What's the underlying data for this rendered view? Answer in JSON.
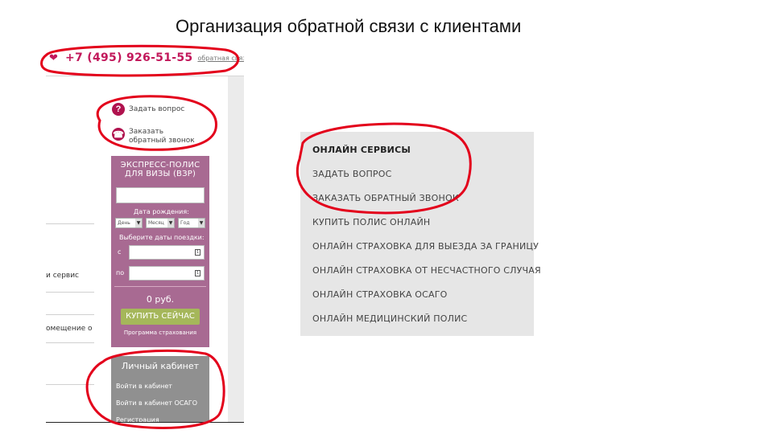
{
  "slide": {
    "title": "Организация обратной связи с клиентами"
  },
  "left_screenshot": {
    "header": {
      "phone": "+7 (495) 926-51-55",
      "feedback_link": "обратная связь"
    },
    "actions": [
      {
        "label": "Задать вопрос",
        "icon": "?"
      },
      {
        "label_line1": "Заказать",
        "label_line2": "обратный звонок"
      }
    ],
    "left_fragments": [
      "и сервис",
      "омещение о"
    ],
    "express_widget": {
      "title_line1": "ЭКСПРЕСС-ПОЛИС",
      "title_line2": "ДЛЯ ВИЗЫ (ВЗР)",
      "birthdate_label": "Дата рождения:",
      "day": "День",
      "month": "Месяц",
      "year": "Год",
      "dates_label": "Выберите даты поездки:",
      "from_label": "с",
      "to_label": "по",
      "price": "0 руб.",
      "buy_button": "КУПИТЬ СЕЙЧАС",
      "program_link": "Программа страхования"
    },
    "cabinet": {
      "title": "Личный кабинет",
      "links": [
        "Войти в кабинет",
        "Войти в кабинет ОСАГО",
        "Регистрация"
      ]
    }
  },
  "right_screenshot": {
    "menu": [
      "ОНЛАЙН СЕРВИСЫ",
      "ЗАДАТЬ ВОПРОС",
      "ЗАКАЗАТЬ ОБРАТНЫЙ ЗВОНОК",
      "КУПИТЬ ПОЛИС ОНЛАЙН",
      "ОНЛАЙН СТРАХОВКА ДЛЯ ВЫЕЗДА ЗА ГРАНИЦУ",
      "ОНЛАЙН СТРАХОВКА ОТ НЕСЧАСТНОГО СЛУЧАЯ",
      "ОНЛАЙН СТРАХОВКА ОСАГО",
      "ОНЛАЙН МЕДИЦИНСКИЙ ПОЛИС"
    ]
  },
  "colors": {
    "brand": "#c2185b",
    "widget_bg": "#a86a92",
    "buy_button": "#a5b75a",
    "cabinet_bg": "#909090",
    "annotation": "#e3001b"
  }
}
